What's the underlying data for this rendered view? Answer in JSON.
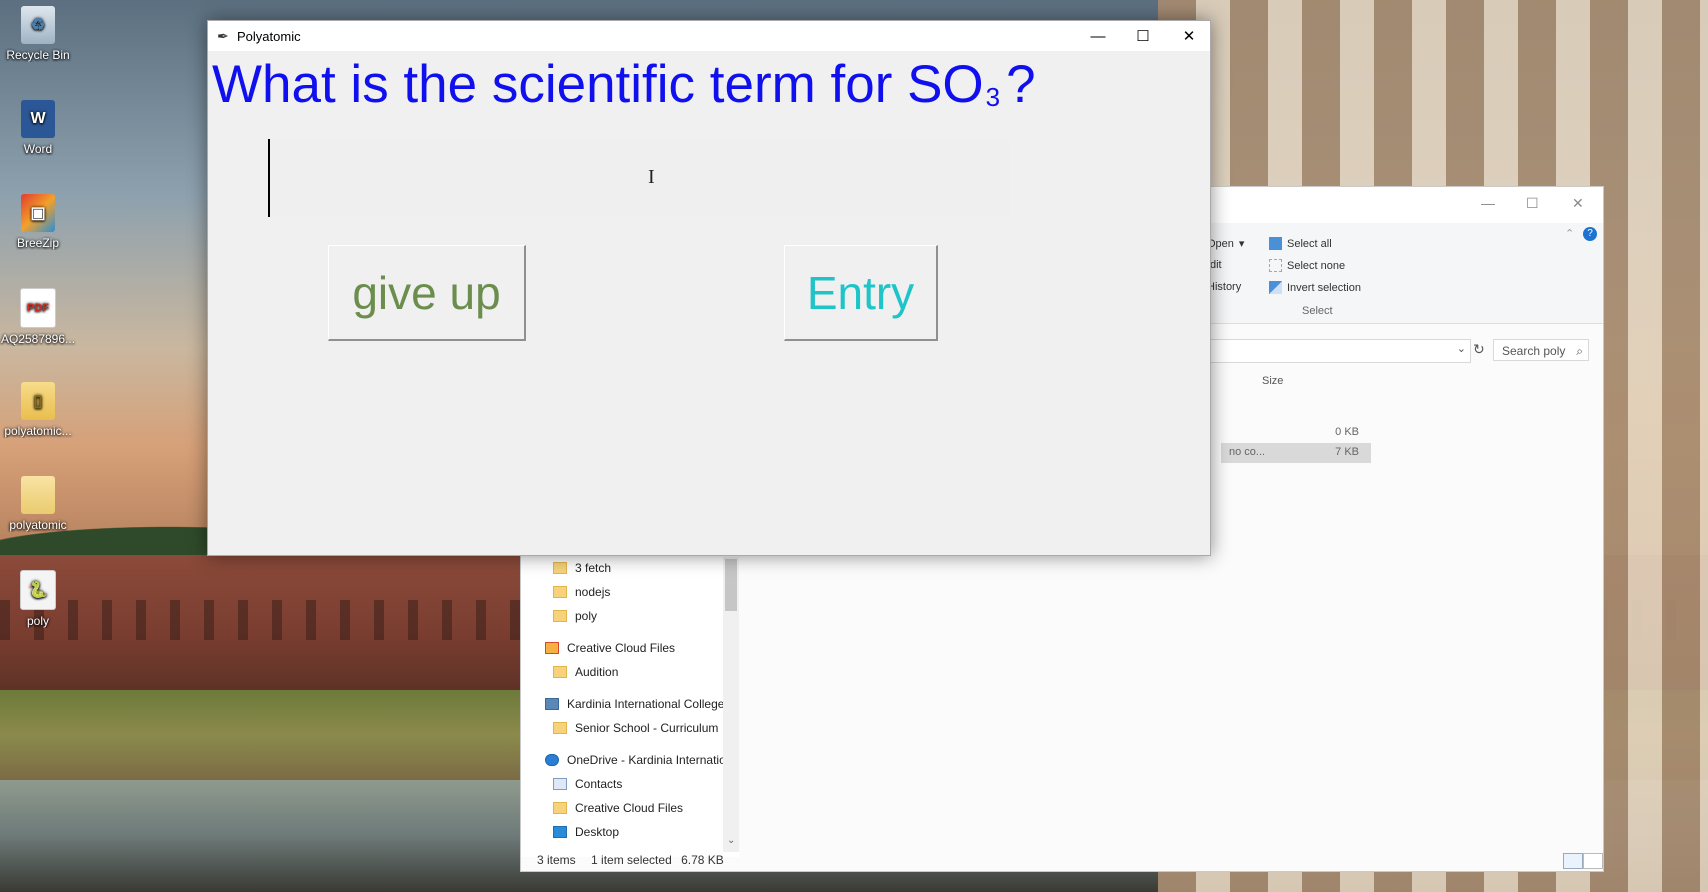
{
  "desktop": {
    "icons": [
      {
        "label": "Recycle Bin",
        "icon": "recycle-bin-icon"
      },
      {
        "label": "Word",
        "icon": "word-icon"
      },
      {
        "label": "BreeZip",
        "icon": "breezip-icon"
      },
      {
        "label": "AQ2587896...",
        "icon": "pdf-icon"
      },
      {
        "label": "polyatomic...",
        "icon": "zip-folder-icon"
      },
      {
        "label": "polyatomic",
        "icon": "folder-icon"
      },
      {
        "label": "poly",
        "icon": "python-file-icon"
      }
    ]
  },
  "explorer": {
    "ribbon": {
      "open_label": "Open",
      "edit_label": "dit",
      "history_label": "History",
      "select_all": "Select all",
      "select_none": "Select none",
      "invert_selection": "Invert selection",
      "group_select": "Select"
    },
    "search_placeholder": "Search poly",
    "column_size": "Size",
    "files": [
      {
        "name": "",
        "size": "0 KB"
      },
      {
        "name": "no co...",
        "size": "7 KB"
      }
    ],
    "nav_items": [
      {
        "label": "3 fetch",
        "icon": "folder-icon"
      },
      {
        "label": "nodejs",
        "icon": "folder-icon"
      },
      {
        "label": "poly",
        "icon": "folder-icon"
      },
      {
        "label": "Creative Cloud Files",
        "icon": "creative-cloud-icon"
      },
      {
        "label": "Audition",
        "icon": "folder-icon"
      },
      {
        "label": "Kardinia International College",
        "icon": "building-icon"
      },
      {
        "label": "Senior School - Curriculum",
        "icon": "folder-icon"
      },
      {
        "label": "OneDrive - Kardinia Internatio",
        "icon": "onedrive-icon"
      },
      {
        "label": "Contacts",
        "icon": "contacts-icon"
      },
      {
        "label": "Creative Cloud Files",
        "icon": "folder-icon"
      },
      {
        "label": "Desktop",
        "icon": "desktop-icon"
      }
    ],
    "status": {
      "items": "3 items",
      "selected": "1 item selected",
      "size": "6.78 KB"
    }
  },
  "poly_window": {
    "title": "Polyatomic",
    "question_prefix": "What is the scientific term for SO",
    "question_subscript": "3",
    "question_suffix": "?",
    "answer_value": "",
    "give_up_label": "give up",
    "entry_label": "Entry",
    "colors": {
      "question": "#1010ee",
      "give_up": "#6b8e4e",
      "entry": "#1fc4c8"
    }
  }
}
